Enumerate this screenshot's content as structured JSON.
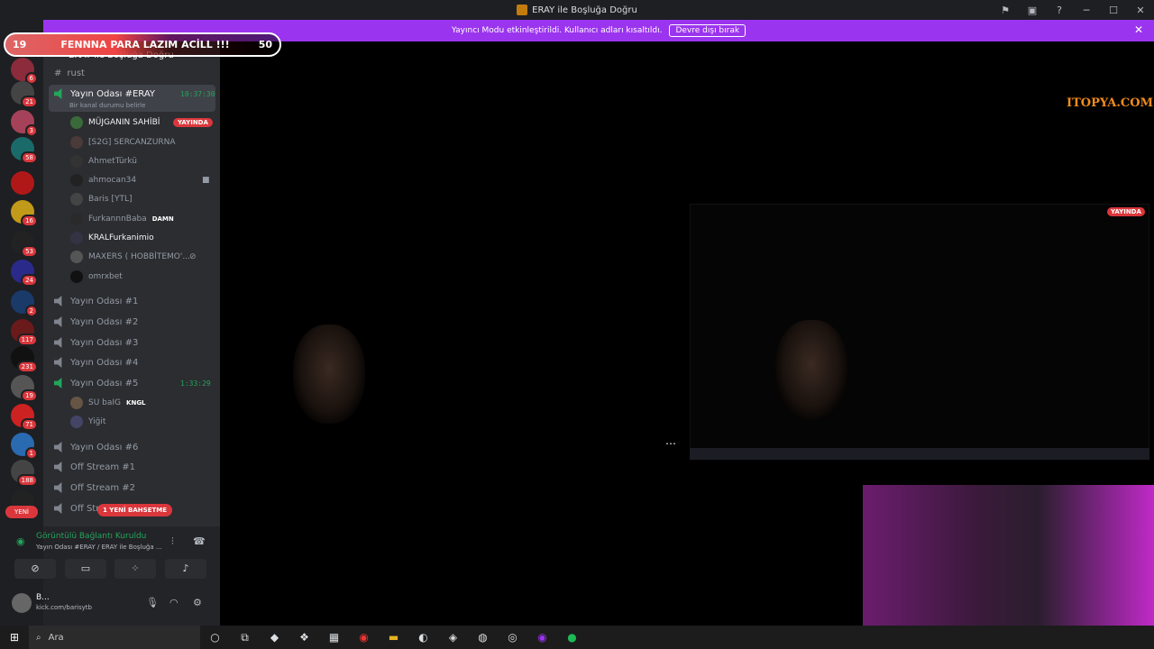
{
  "window": {
    "title": "ERAY ile Boşluğa Doğru"
  },
  "banner": {
    "text": "Yayıncı Modu etkinleştirildi. Kullanıcı adları kısaltıldı.",
    "button": "Devre dışı bırak"
  },
  "overlay": {
    "left": "19",
    "middle": "FENNNA PARA LAZIM ACİLL !!!",
    "right": "50"
  },
  "server": {
    "name": "ERAY ile Boşluğa Doğru"
  },
  "guild_badges": [
    "6",
    "21",
    "3",
    "58",
    "16",
    "53",
    "24",
    "2",
    "117",
    "231",
    "19",
    "71",
    "1",
    "188"
  ],
  "guild_new": "YENİ",
  "channels": {
    "text_rust": "rust",
    "active": {
      "name": "Yayın Odası #ERAY",
      "time": "10:37:30",
      "status": "Bir kanal durumu belirle"
    },
    "users": [
      {
        "name": "MÜJGANIN SAHİBİ",
        "tag": "YAYINDA"
      },
      {
        "name": "[S2G] SERCANZURNA"
      },
      {
        "name": "AhmetTürkü"
      },
      {
        "name": "ahmocan34"
      },
      {
        "name": "Baris [YTL]"
      },
      {
        "name": "FurkannnBaba",
        "tag": "DAMN"
      },
      {
        "name": "KRALFurkanimio"
      },
      {
        "name": "MAXERS ( HOBBİTEMO'..."
      },
      {
        "name": "omrxbet"
      }
    ],
    "rooms": [
      "Yayın Odası #1",
      "Yayın Odası #2",
      "Yayın Odası #3",
      "Yayın Odası #4"
    ],
    "room5": {
      "name": "Yayın Odası #5",
      "time": "1:33:29"
    },
    "room5_users": [
      {
        "name": "SU baIG",
        "tag": "KNGL"
      },
      {
        "name": "Yiğit"
      }
    ],
    "rooms2": [
      "Yayın Odası #6",
      "Off Stream #1",
      "Off Stream #2",
      "Off Str"
    ],
    "mention": "1 YENİ BAHSETME"
  },
  "voice": {
    "status": "Görüntülü Bağlantı Kuruldu",
    "sub": "Yayın Odası #ERAY / ERAY ile Boşluğa ..."
  },
  "user": {
    "name": "B...",
    "status": "kick.com/barisytb"
  },
  "stage": {
    "brand": "ITOPYA.COM",
    "live": "YAYINDA"
  },
  "taskbar": {
    "search": "Ara"
  },
  "colors": {
    "accent": "#9b34ef",
    "live": "#da373c",
    "online": "#23a55a"
  }
}
